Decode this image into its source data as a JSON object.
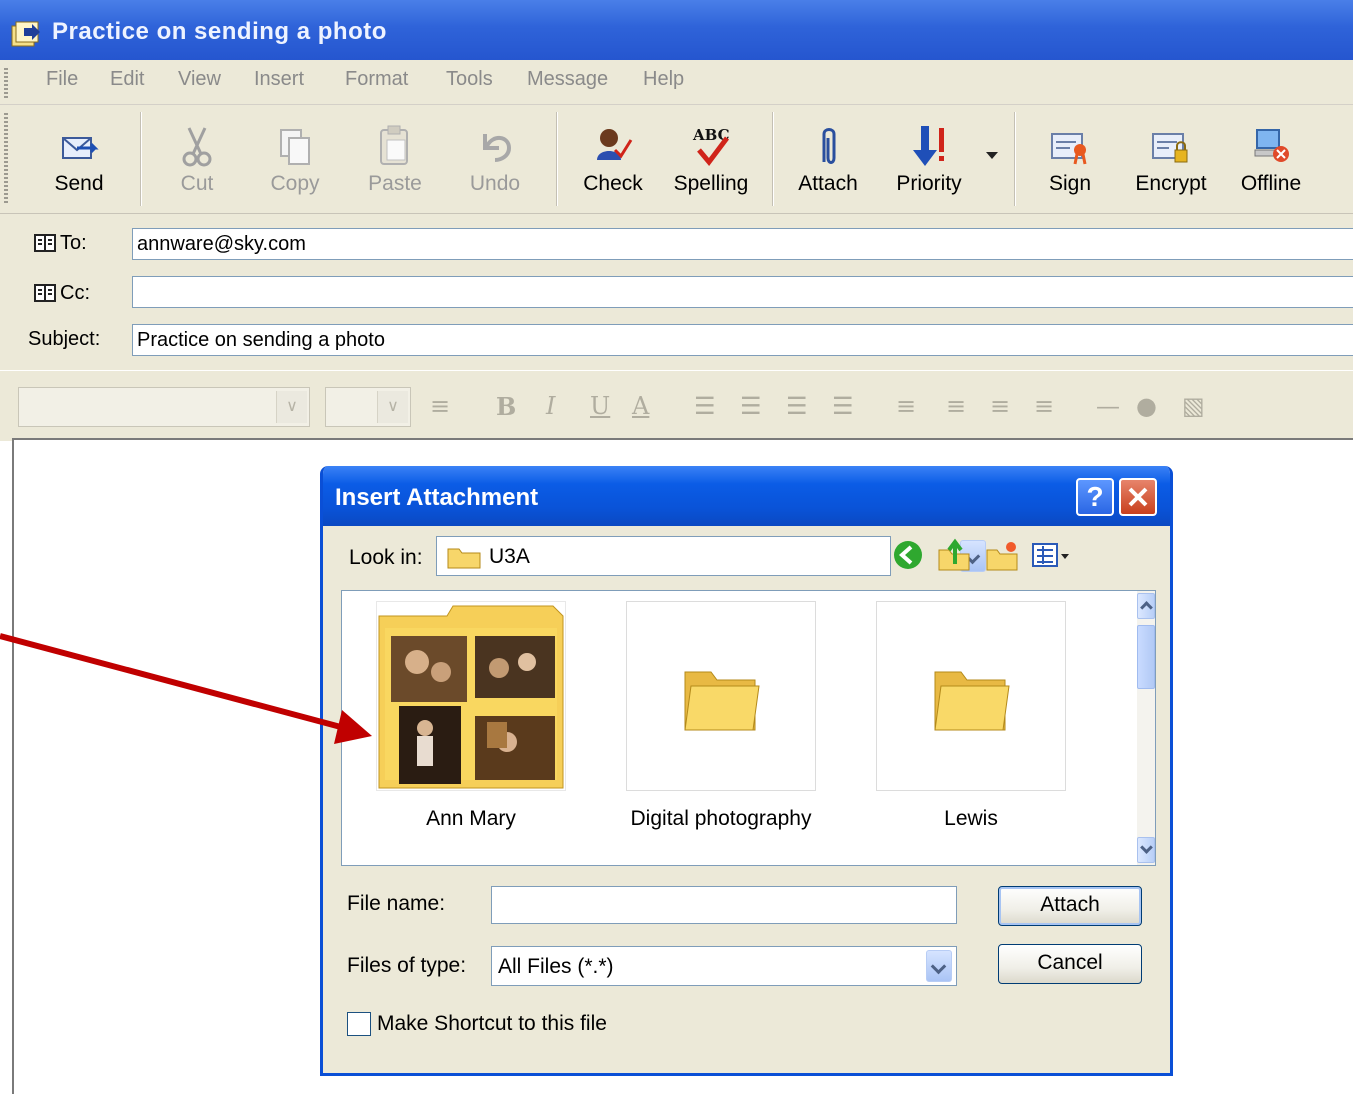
{
  "window": {
    "title": "Practice on sending a photo"
  },
  "menu": [
    "File",
    "Edit",
    "View",
    "Insert",
    "Format",
    "Tools",
    "Message",
    "Help"
  ],
  "toolbar": {
    "send": "Send",
    "cut": "Cut",
    "copy": "Copy",
    "paste": "Paste",
    "undo": "Undo",
    "check": "Check",
    "spelling": "Spelling",
    "attach": "Attach",
    "priority": "Priority",
    "sign": "Sign",
    "encrypt": "Encrypt",
    "offline": "Offline"
  },
  "headers": {
    "to_label": "To:",
    "to_value": "annware@sky.com",
    "cc_label": "Cc:",
    "cc_value": "",
    "subject_label": "Subject:",
    "subject_value": "Practice on sending a photo"
  },
  "dialog": {
    "title": "Insert Attachment",
    "help": "?",
    "look_in_label": "Look in:",
    "look_in_value": "U3A",
    "items": [
      {
        "label": "Ann Mary"
      },
      {
        "label": "Digital photography"
      },
      {
        "label": "Lewis"
      }
    ],
    "file_name_label": "File name:",
    "file_name_value": "",
    "files_of_type_label": "Files of type:",
    "files_of_type_value": "All Files (*.*)",
    "attach_button": "Attach",
    "cancel_button": "Cancel",
    "shortcut_label": "Make Shortcut to this file",
    "shortcut_checked": false
  },
  "colors": {
    "titlebar": "#2f63d9",
    "dialog_titlebar": "#0a53d8",
    "close_button": "#c8401e",
    "annotation_arrow": "#c00000"
  }
}
